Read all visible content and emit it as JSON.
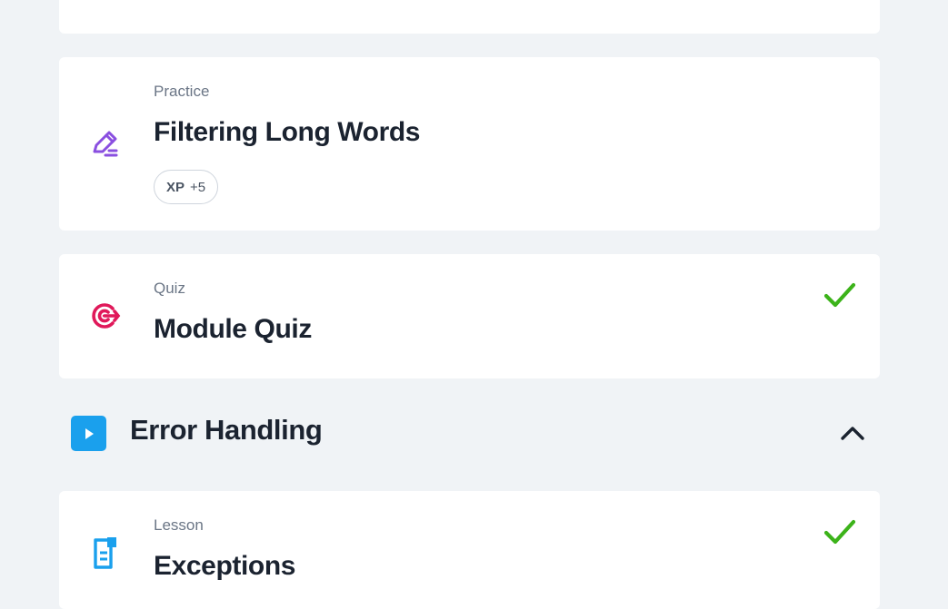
{
  "items": [
    {
      "type": "Practice",
      "title": "Filtering Long Words",
      "xp": {
        "label": "XP",
        "value": "+5"
      },
      "icon": "practice-pencil-icon",
      "completed": false
    },
    {
      "type": "Quiz",
      "title": "Module Quiz",
      "icon": "quiz-target-icon",
      "completed": true
    }
  ],
  "section": {
    "title": "Error Handling",
    "icon": "play-icon",
    "expanded": true
  },
  "section_items": [
    {
      "type": "Lesson",
      "title": "Exceptions",
      "icon": "lesson-document-icon",
      "completed": true
    }
  ],
  "colors": {
    "background": "#f0f3f6",
    "card": "#ffffff",
    "practice_icon": "#8a4fe0",
    "quiz_icon": "#e0195a",
    "lesson_icon": "#1aa0ed",
    "section_icon": "#1aa0ed",
    "check": "#3cb31a",
    "title_text": "#1b2330"
  }
}
